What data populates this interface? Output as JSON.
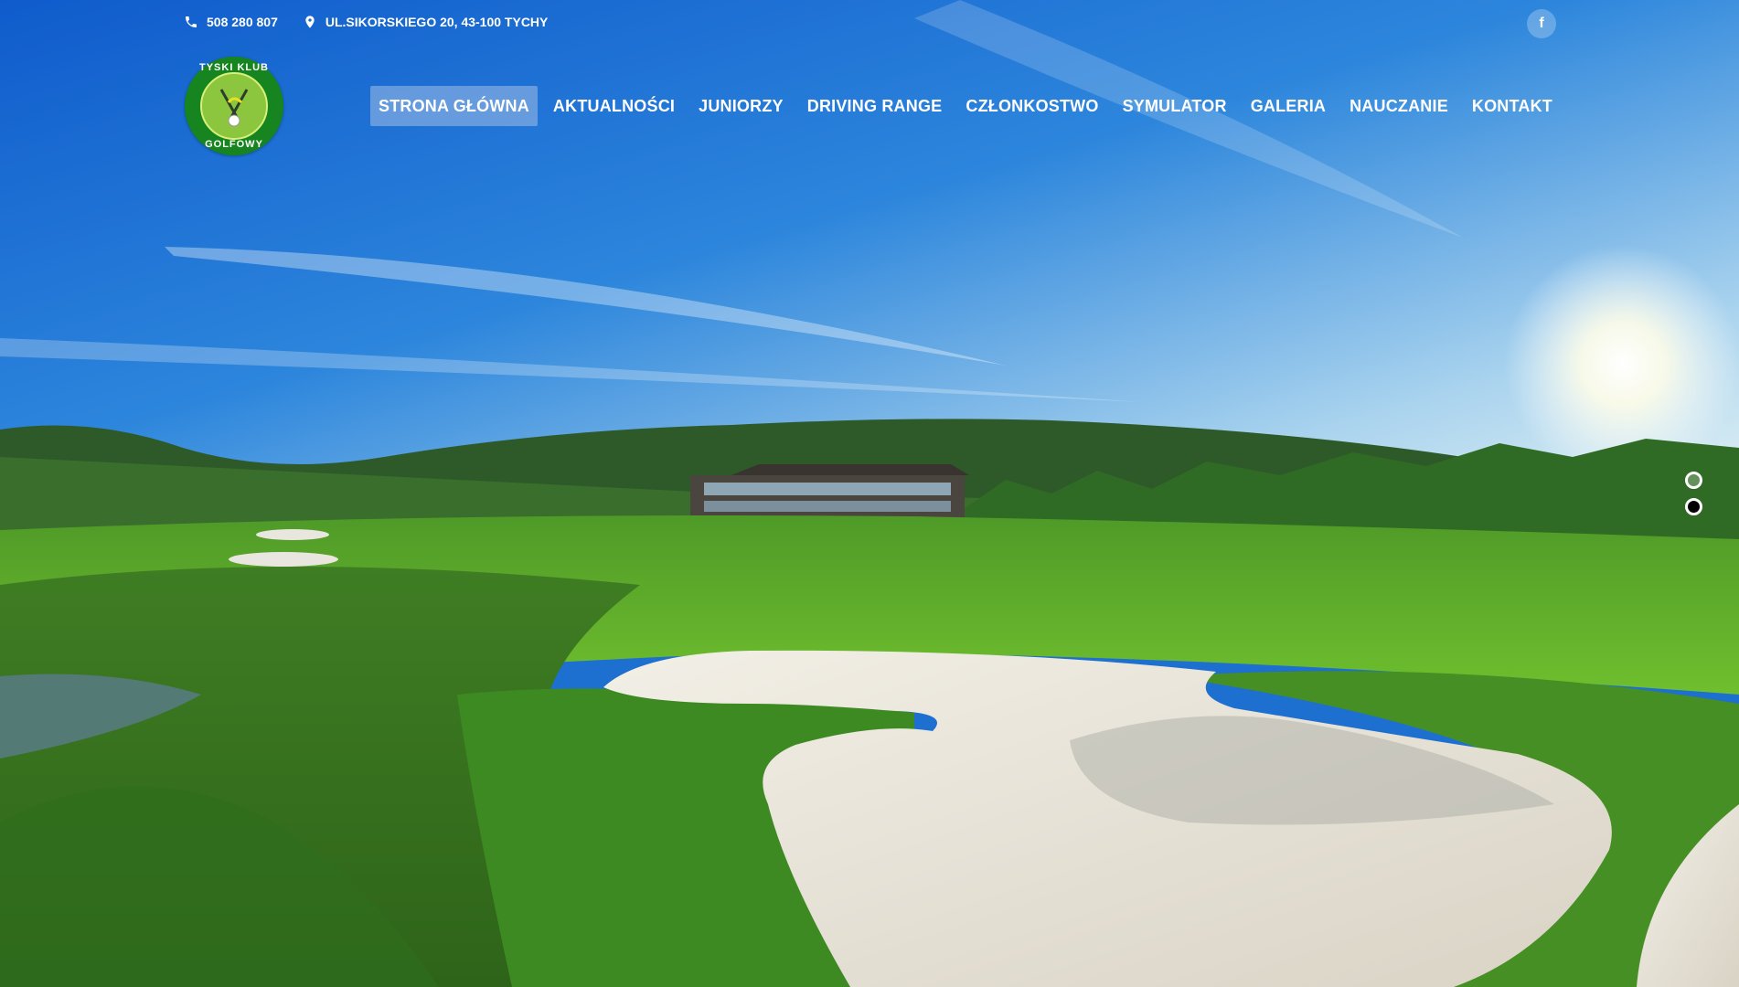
{
  "topbar": {
    "phone": "508 280 807",
    "address": "UL.SIKORSKIEGO 20, 43-100 TYCHY",
    "phone_icon": "phone-icon",
    "address_icon": "map-pin-icon",
    "social_icon": "facebook-icon",
    "social_glyph": "f"
  },
  "logo": {
    "text_top": "TYSKI KLUB",
    "text_bottom": "GOLFOWY"
  },
  "nav": {
    "items": [
      {
        "label": "STRONA GŁÓWNA",
        "active": true
      },
      {
        "label": "AKTUALNOŚCI"
      },
      {
        "label": "JUNIORZY"
      },
      {
        "label": "DRIVING RANGE"
      },
      {
        "label": "CZŁONKOSTWO"
      },
      {
        "label": "SYMULATOR"
      },
      {
        "label": "GALERIA"
      },
      {
        "label": "NAUCZANIE"
      },
      {
        "label": "KONTAKT"
      }
    ]
  },
  "slider": {
    "dot_count": 2,
    "active_index": 1
  },
  "colors": {
    "sky_top": "#1565d0",
    "sky_horizon": "#bfe0f0",
    "grass": "#5fae2a",
    "sand": "#e8e4d8",
    "logo_green": "#17851f"
  }
}
